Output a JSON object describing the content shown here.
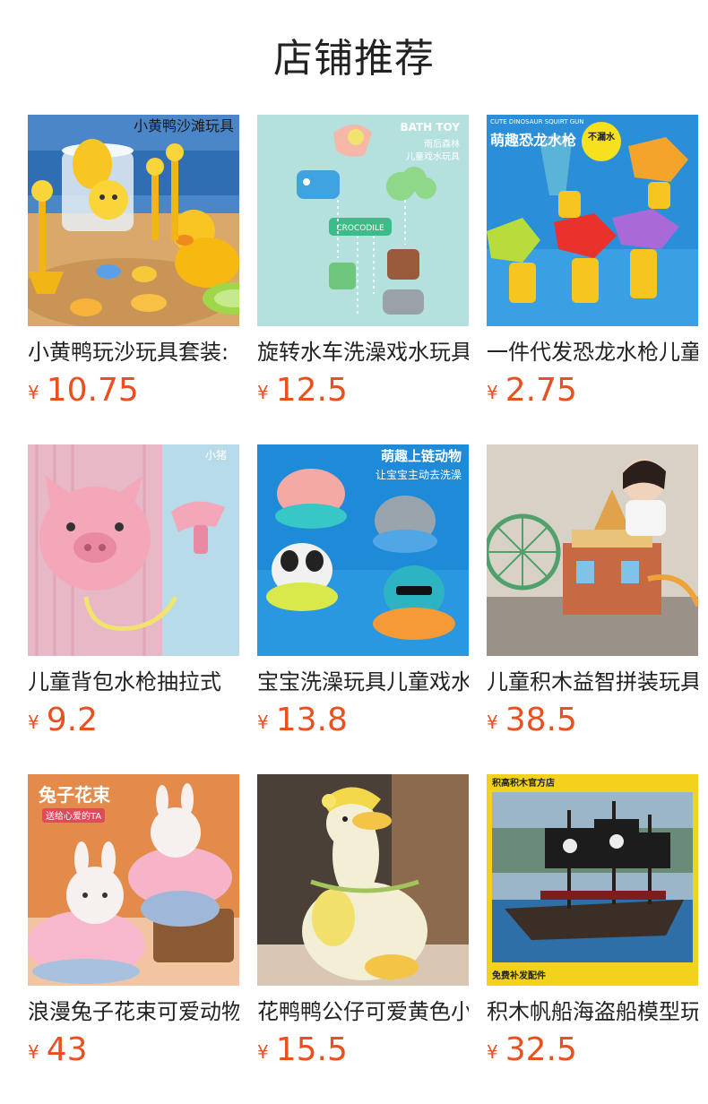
{
  "page": {
    "title": "店铺推荐",
    "currency_symbol": "¥",
    "accent_color": "#e8501f"
  },
  "products": [
    {
      "name": "小黄鸭玩沙玩具套装:",
      "price": "10.75",
      "image_caption": "小黄鸭沙滩玩具"
    },
    {
      "name": "旋转水车洗澡戏水玩具",
      "price": "12.5",
      "image_caption": "BATH TOY",
      "image_sub": "雨后森林",
      "image_sub2": "儿童戏水玩具",
      "image_tag": "CROCODILE"
    },
    {
      "name": "一件代发恐龙水枪儿童",
      "price": "2.75",
      "image_caption": "萌趣恐龙水枪",
      "image_sub": "CUTE DINOSAUR SQUIRT GUN",
      "image_badge": "不漏水"
    },
    {
      "name": "儿童背包水枪抽拉式",
      "price": "9.2",
      "image_caption": "小猪"
    },
    {
      "name": "宝宝洗澡玩具儿童戏水",
      "price": "13.8",
      "image_caption": "萌趣上链动物",
      "image_sub": "让宝宝主动去洗澡"
    },
    {
      "name": "儿童积木益智拼装玩具",
      "price": "38.5"
    },
    {
      "name": "浪漫兔子花束可爱动物",
      "price": "43",
      "image_caption": "兔子花束",
      "image_sub": "送给心爱的TA"
    },
    {
      "name": "花鸭鸭公仔可爱黄色小鸭",
      "price": "15.5"
    },
    {
      "name": "积木帆船海盗船模型玩具",
      "price": "32.5",
      "image_caption": "积高积木官方店",
      "image_sub": "免费补发配件"
    }
  ]
}
